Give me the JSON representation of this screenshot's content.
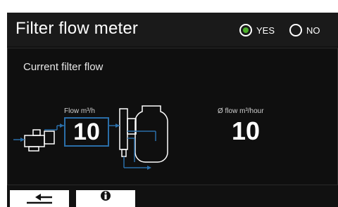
{
  "header": {
    "title": "Filter flow meter",
    "options": [
      {
        "label": "YES",
        "selected": true
      },
      {
        "label": "NO",
        "selected": false
      }
    ]
  },
  "panel": {
    "title": "Current filter flow",
    "flow_caption": "Flow m³/h",
    "flow_value": "10",
    "avg_caption": "Ø flow m³/hour",
    "avg_value": "10"
  },
  "colors": {
    "accent": "#2a6ea8",
    "radio_selected": "#4caf2a",
    "background": "#111111"
  },
  "buttons": [
    {
      "icon": "return-arrow-icon"
    },
    {
      "icon": "info-icon"
    }
  ]
}
